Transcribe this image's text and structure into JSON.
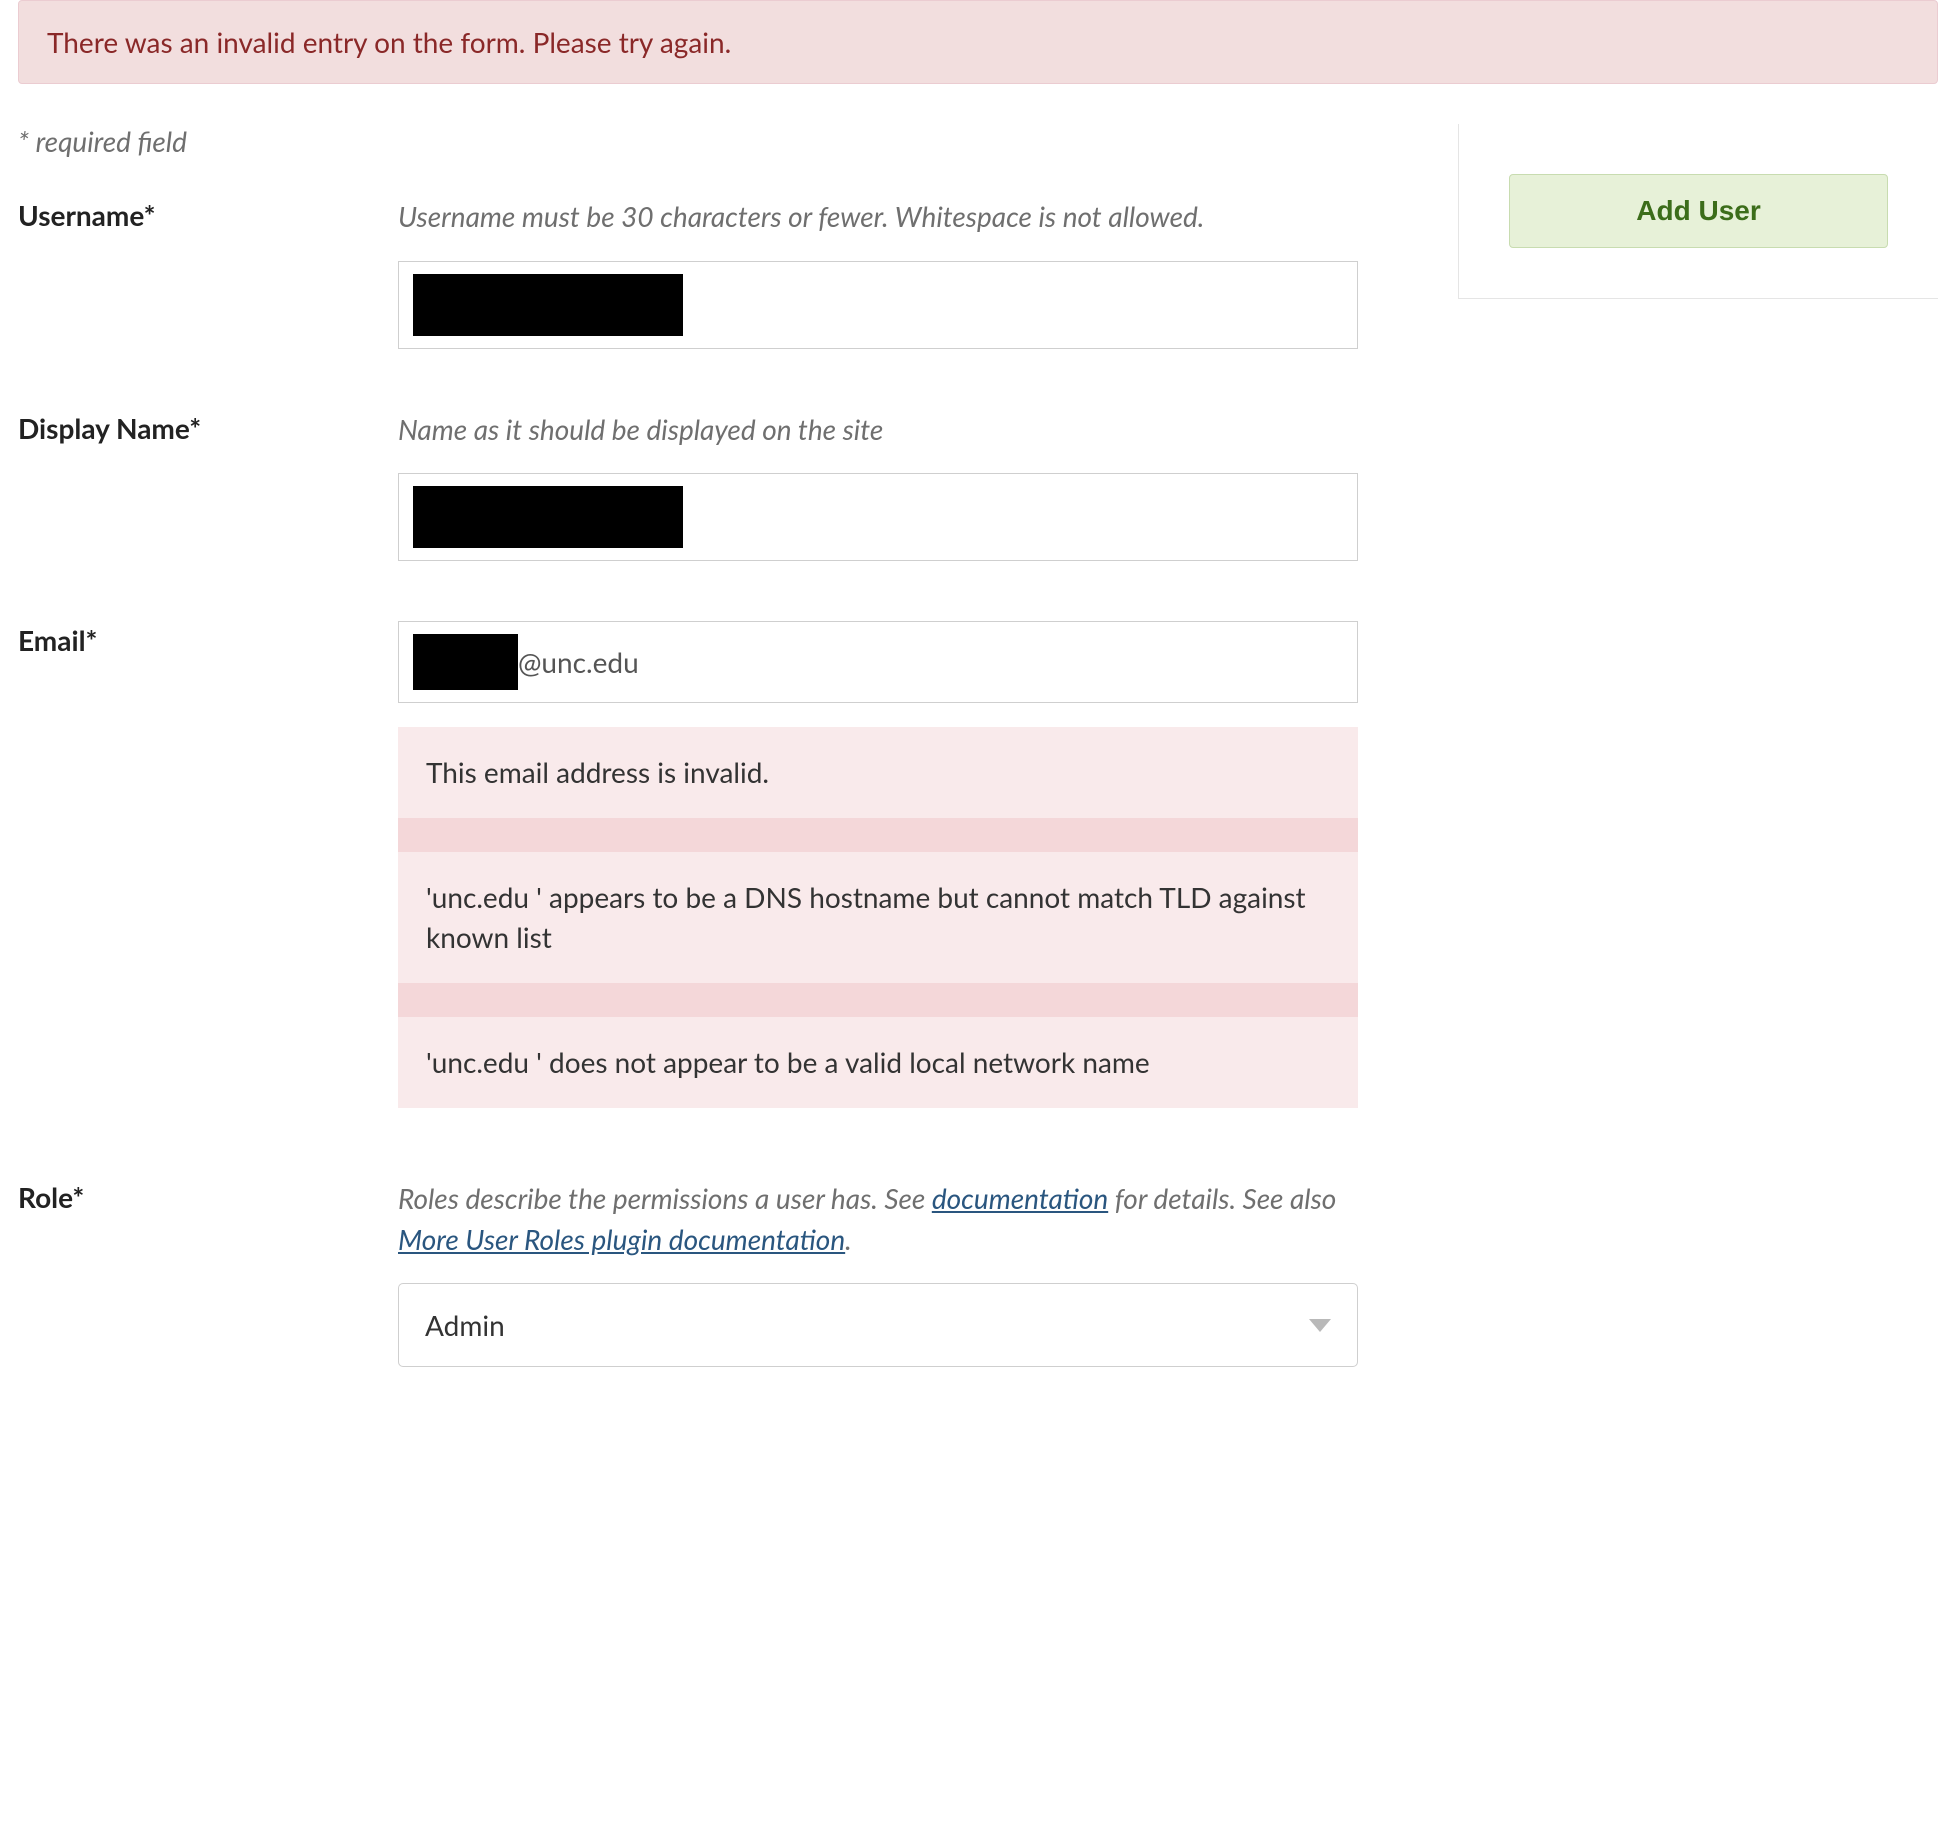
{
  "alert": {
    "message": "There was an invalid entry on the form. Please try again."
  },
  "required_note": "* required field",
  "form": {
    "username": {
      "label": "Username*",
      "help": "Username must be 30 characters or fewer. Whitespace is not allowed.",
      "value_redacted": true
    },
    "display_name": {
      "label": "Display Name*",
      "help": "Name as it should be displayed on the site",
      "value_redacted": true
    },
    "email": {
      "label": "Email*",
      "value_prefix_redacted": true,
      "value_suffix": "@unc.edu",
      "errors": [
        "This email address is invalid.",
        "'unc.edu ' appears to be a DNS hostname but cannot match TLD against known list",
        "'unc.edu ' does not appear to be a valid local network name"
      ]
    },
    "role": {
      "label": "Role*",
      "help_pre": "Roles describe the permissions a user has. See ",
      "help_link1": "documentation",
      "help_mid": " for details. See also ",
      "help_link2": "More User Roles plugin documentation",
      "help_post": ".",
      "selected": "Admin"
    }
  },
  "side": {
    "add_user_label": "Add User"
  }
}
